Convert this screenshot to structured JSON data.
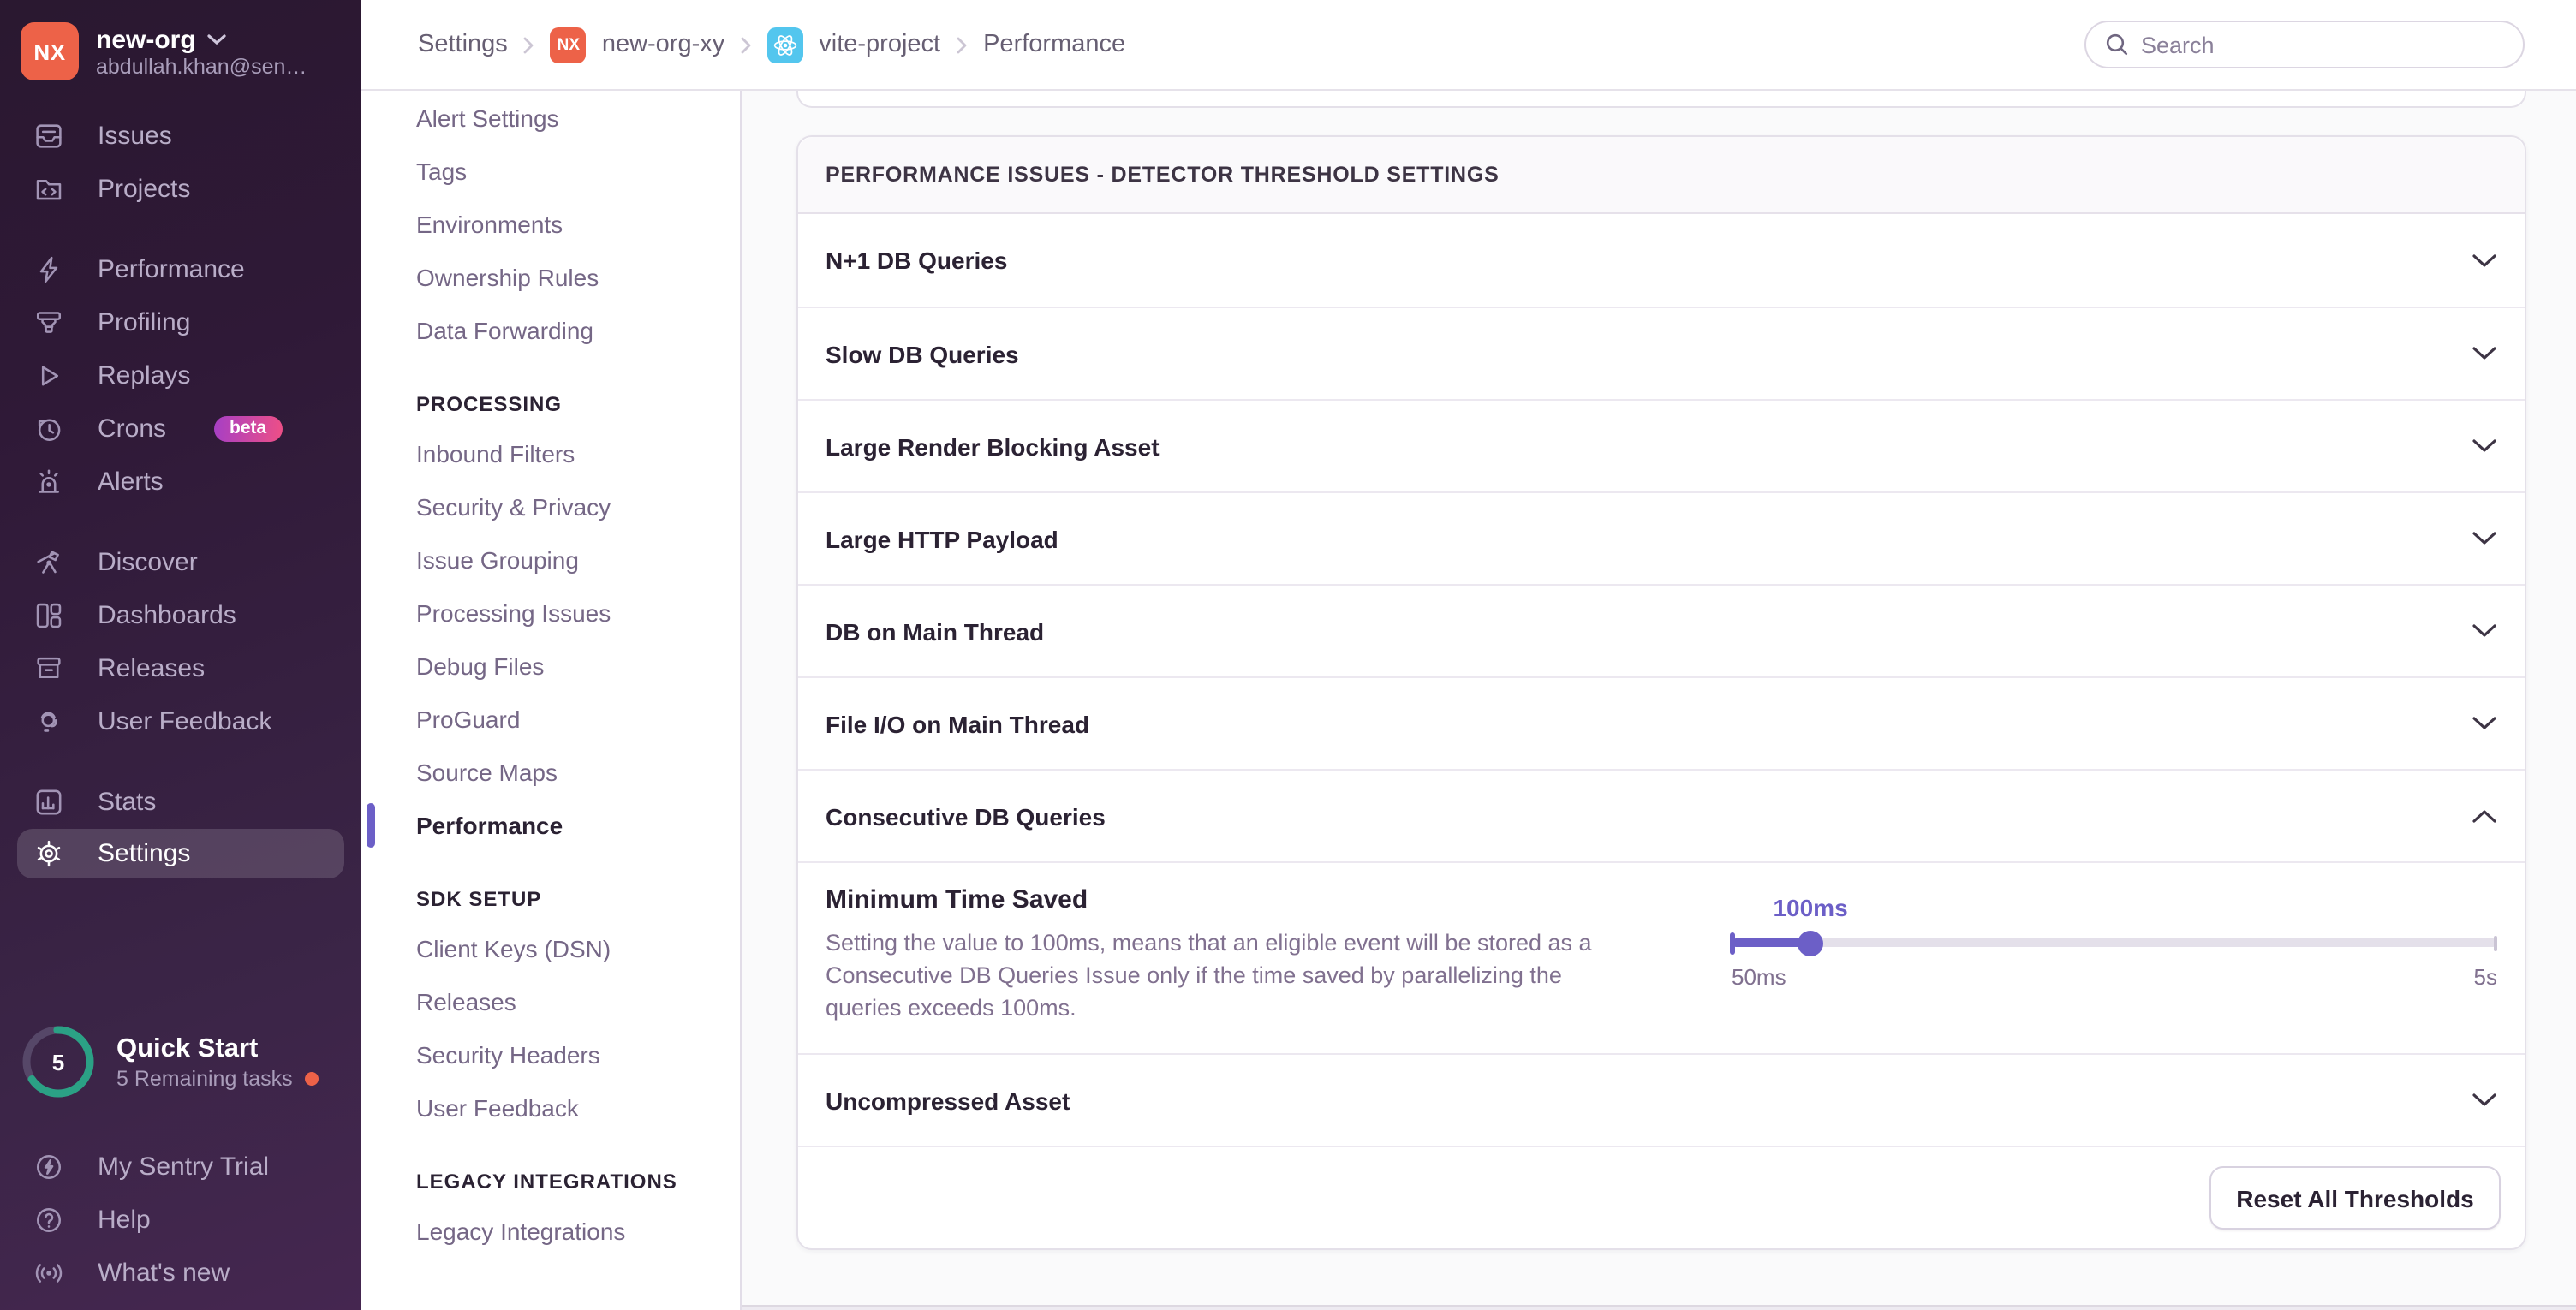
{
  "sidebar": {
    "org_name": "new-org",
    "org_initials": "NX",
    "email": "abdullah.khan@sen…",
    "items": [
      {
        "label": "Issues"
      },
      {
        "label": "Projects"
      },
      {
        "label": "Performance"
      },
      {
        "label": "Profiling"
      },
      {
        "label": "Replays"
      },
      {
        "label": "Crons",
        "badge": "beta"
      },
      {
        "label": "Alerts"
      },
      {
        "label": "Discover"
      },
      {
        "label": "Dashboards"
      },
      {
        "label": "Releases"
      },
      {
        "label": "User Feedback"
      },
      {
        "label": "Stats"
      },
      {
        "label": "Settings",
        "active": true
      }
    ],
    "quick_start": {
      "title": "Quick Start",
      "subtitle": "5 Remaining tasks",
      "count": "5"
    },
    "footer_items": [
      {
        "label": "My Sentry Trial"
      },
      {
        "label": "Help"
      },
      {
        "label": "What's new"
      }
    ]
  },
  "header": {
    "breadcrumbs": [
      {
        "label": "Settings"
      },
      {
        "label": "new-org-xy",
        "badge": "NX"
      },
      {
        "label": "vite-project",
        "badge": "react"
      },
      {
        "label": "Performance"
      }
    ],
    "search": {
      "placeholder": "Search"
    }
  },
  "settings_nav": {
    "groups": [
      {
        "header": "",
        "items": [
          {
            "label": "Alert Settings"
          },
          {
            "label": "Tags"
          },
          {
            "label": "Environments"
          },
          {
            "label": "Ownership Rules"
          },
          {
            "label": "Data Forwarding"
          }
        ]
      },
      {
        "header": "PROCESSING",
        "items": [
          {
            "label": "Inbound Filters"
          },
          {
            "label": "Security & Privacy"
          },
          {
            "label": "Issue Grouping"
          },
          {
            "label": "Processing Issues"
          },
          {
            "label": "Debug Files"
          },
          {
            "label": "ProGuard"
          },
          {
            "label": "Source Maps"
          },
          {
            "label": "Performance",
            "active": true
          }
        ]
      },
      {
        "header": "SDK SETUP",
        "items": [
          {
            "label": "Client Keys (DSN)"
          },
          {
            "label": "Releases"
          },
          {
            "label": "Security Headers"
          },
          {
            "label": "User Feedback"
          }
        ]
      },
      {
        "header": "LEGACY INTEGRATIONS",
        "items": [
          {
            "label": "Legacy Integrations"
          }
        ]
      }
    ]
  },
  "panel": {
    "title": "PERFORMANCE ISSUES - DETECTOR THRESHOLD SETTINGS",
    "rows": [
      {
        "label": "N+1 DB Queries",
        "state": "collapsed"
      },
      {
        "label": "Slow DB Queries",
        "state": "collapsed"
      },
      {
        "label": "Large Render Blocking Asset",
        "state": "collapsed"
      },
      {
        "label": "Large HTTP Payload",
        "state": "collapsed"
      },
      {
        "label": "DB on Main Thread",
        "state": "collapsed"
      },
      {
        "label": "File I/O on Main Thread",
        "state": "collapsed"
      },
      {
        "label": "Consecutive DB Queries",
        "state": "expanded"
      },
      {
        "label": "Uncompressed Asset",
        "state": "collapsed"
      }
    ],
    "expanded_field": {
      "label": "Minimum Time Saved",
      "description": "Setting the value to 100ms, means that an eligible event will be stored as a Consecutive DB Queries Issue only if the time saved by parallelizing the queries exceeds 100ms.",
      "slider": {
        "value_label": "100ms",
        "min_label": "50ms",
        "max_label": "5s",
        "percent_filled": 10.3
      }
    },
    "footer": {
      "reset_label": "Reset All Thresholds"
    }
  },
  "colors": {
    "accent_purple": "#6C5FC7",
    "org_avatar_orange": "#ED6248",
    "react_project_blue": "#53C6EE",
    "quickstart_teal": "#2BA185",
    "notification_dot_orange": "#ED6248",
    "beta_badge_gradient_start": "#A63FC5",
    "beta_badge_gradient_end": "#EE4F86",
    "sidebar_dark_purple": "#2F1937"
  }
}
